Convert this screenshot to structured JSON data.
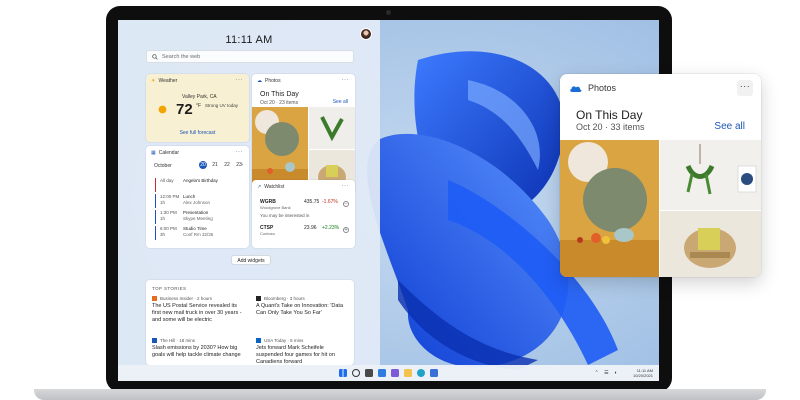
{
  "widgets": {
    "clock": "11:11 AM",
    "search_placeholder": "Search the web",
    "weather": {
      "title": "Weather",
      "location": "Valley Park, CA",
      "temperature": "72",
      "unit": "°F",
      "condition": "Strong UV today",
      "link": "See full forecast"
    },
    "photos": {
      "title": "Photos",
      "heading": "On This Day",
      "subtitle": "Oct 20 · 23 items",
      "see_all": "See all"
    },
    "calendar": {
      "title": "Calendar",
      "month": "October",
      "days": [
        "20",
        "21",
        "22",
        "23"
      ],
      "selected_day": "20",
      "events": [
        {
          "time": "All day",
          "title": "Angela's Birthday",
          "sub": ""
        },
        {
          "time": "12:00 PM",
          "time2": "1h",
          "title": "Lunch",
          "sub": "Alex Johnson"
        },
        {
          "time": "1:30 PM",
          "time2": "1h",
          "title": "Presentation",
          "sub": "Skype Meeting"
        },
        {
          "time": "6:00 PM",
          "time2": "3h",
          "title": "Studio Time",
          "sub": "Conf Rm 32/35"
        }
      ]
    },
    "watchlist": {
      "title": "Watchlist",
      "stocks": [
        {
          "symbol": "WGRB",
          "company": "Woodgrove Bank",
          "price": "435.75",
          "change": "-1.67%",
          "direction": "down"
        }
      ],
      "interested_label": "You may be interested in",
      "suggested": [
        {
          "symbol": "CTSP",
          "company": "Contoso",
          "price": "23.96",
          "change": "+2.23%",
          "direction": "up"
        }
      ]
    },
    "add_widgets_label": "Add widgets",
    "top_stories": {
      "label": "TOP STORIES",
      "items": [
        {
          "source": "Business Insider · 2 hours",
          "headline": "The US Postal Service revealed its first new mail truck in over 30 years - and some will be electric"
        },
        {
          "source": "Bloomberg · 3 hours",
          "headline": "A Quant's Take on Innovation: 'Data Can Only Take You So Far'"
        },
        {
          "source": "The Hill · 18 mins",
          "headline": "Slash emissions by 2030? How big goals will help tackle climate change"
        },
        {
          "source": "USA Today · 5 mins",
          "headline": "Jets forward Mark Scheifele suspended four games for hit on Canadiens forward"
        }
      ]
    }
  },
  "taskbar": {
    "time": "11:11 AM",
    "date": "10/20/2021"
  },
  "photos_popout": {
    "title": "Photos",
    "heading": "On This Day",
    "subtitle": "Oct 20 · 33 items",
    "see_all": "See all"
  },
  "colors": {
    "accent": "#1a56b8",
    "wallpaper": "#a9c4e4",
    "bloom": "#0d47d9"
  }
}
